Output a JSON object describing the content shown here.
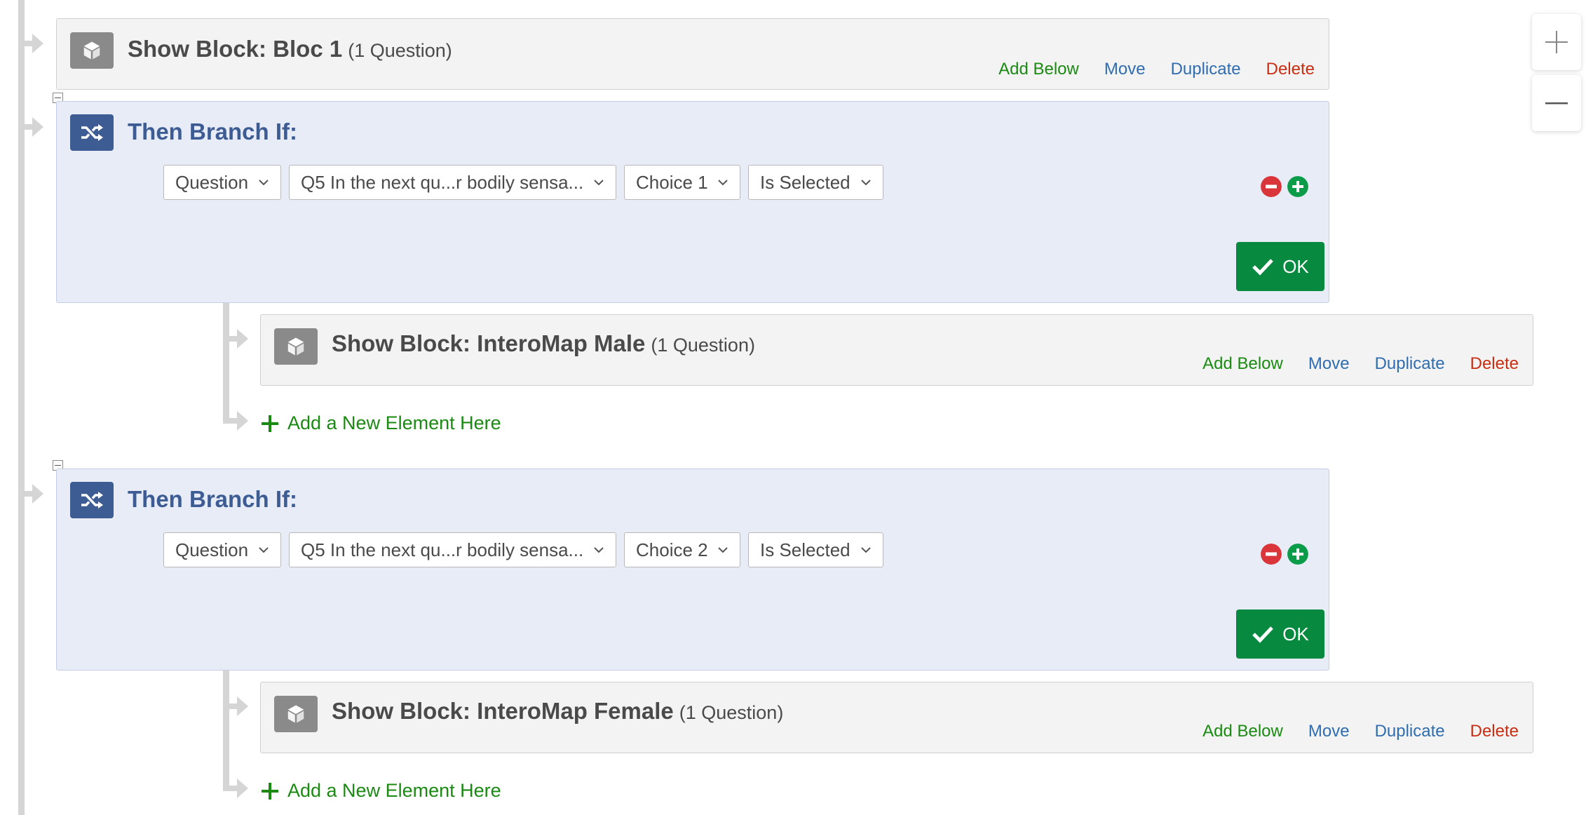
{
  "flow": {
    "show_block_1": {
      "label": "Show Block: Bloc 1",
      "count": "(1 Question)",
      "actions": {
        "add": "Add Below",
        "move": "Move",
        "duplicate": "Duplicate",
        "delete": "Delete"
      }
    },
    "branch_1": {
      "title": "Then Branch If:",
      "condition": {
        "type": "Question",
        "question": "Q5 In the next qu...r bodily sensa...",
        "choice": "Choice 1",
        "operator": "Is Selected"
      },
      "ok_label": "OK",
      "child_block": {
        "label": "Show Block: InteroMap Male",
        "count": "(1 Question)",
        "actions": {
          "add": "Add Below",
          "move": "Move",
          "duplicate": "Duplicate",
          "delete": "Delete"
        }
      },
      "add_new": "Add a New Element Here"
    },
    "branch_2": {
      "title": "Then Branch If:",
      "condition": {
        "type": "Question",
        "question": "Q5 In the next qu...r bodily sensa...",
        "choice": "Choice 2",
        "operator": "Is Selected"
      },
      "ok_label": "OK",
      "child_block": {
        "label": "Show Block: InteroMap Female",
        "count": "(1 Question)",
        "actions": {
          "add": "Add Below",
          "move": "Move",
          "duplicate": "Duplicate",
          "delete": "Delete"
        }
      },
      "add_new": "Add a New Element Here"
    }
  },
  "colors": {
    "accent_green": "#1a8a12",
    "link_blue": "#2f6db0",
    "delete_red": "#c92e12",
    "branch_blue": "#3d5c94",
    "ok_green": "#07893f"
  },
  "icons": [
    "block-cube-icon",
    "branch-shuffle-icon",
    "remove-condition-icon",
    "add-condition-icon",
    "checkmark-icon",
    "plus-icon",
    "zoom-in-icon",
    "zoom-out-icon",
    "chevron-down-icon",
    "collapse-icon"
  ]
}
